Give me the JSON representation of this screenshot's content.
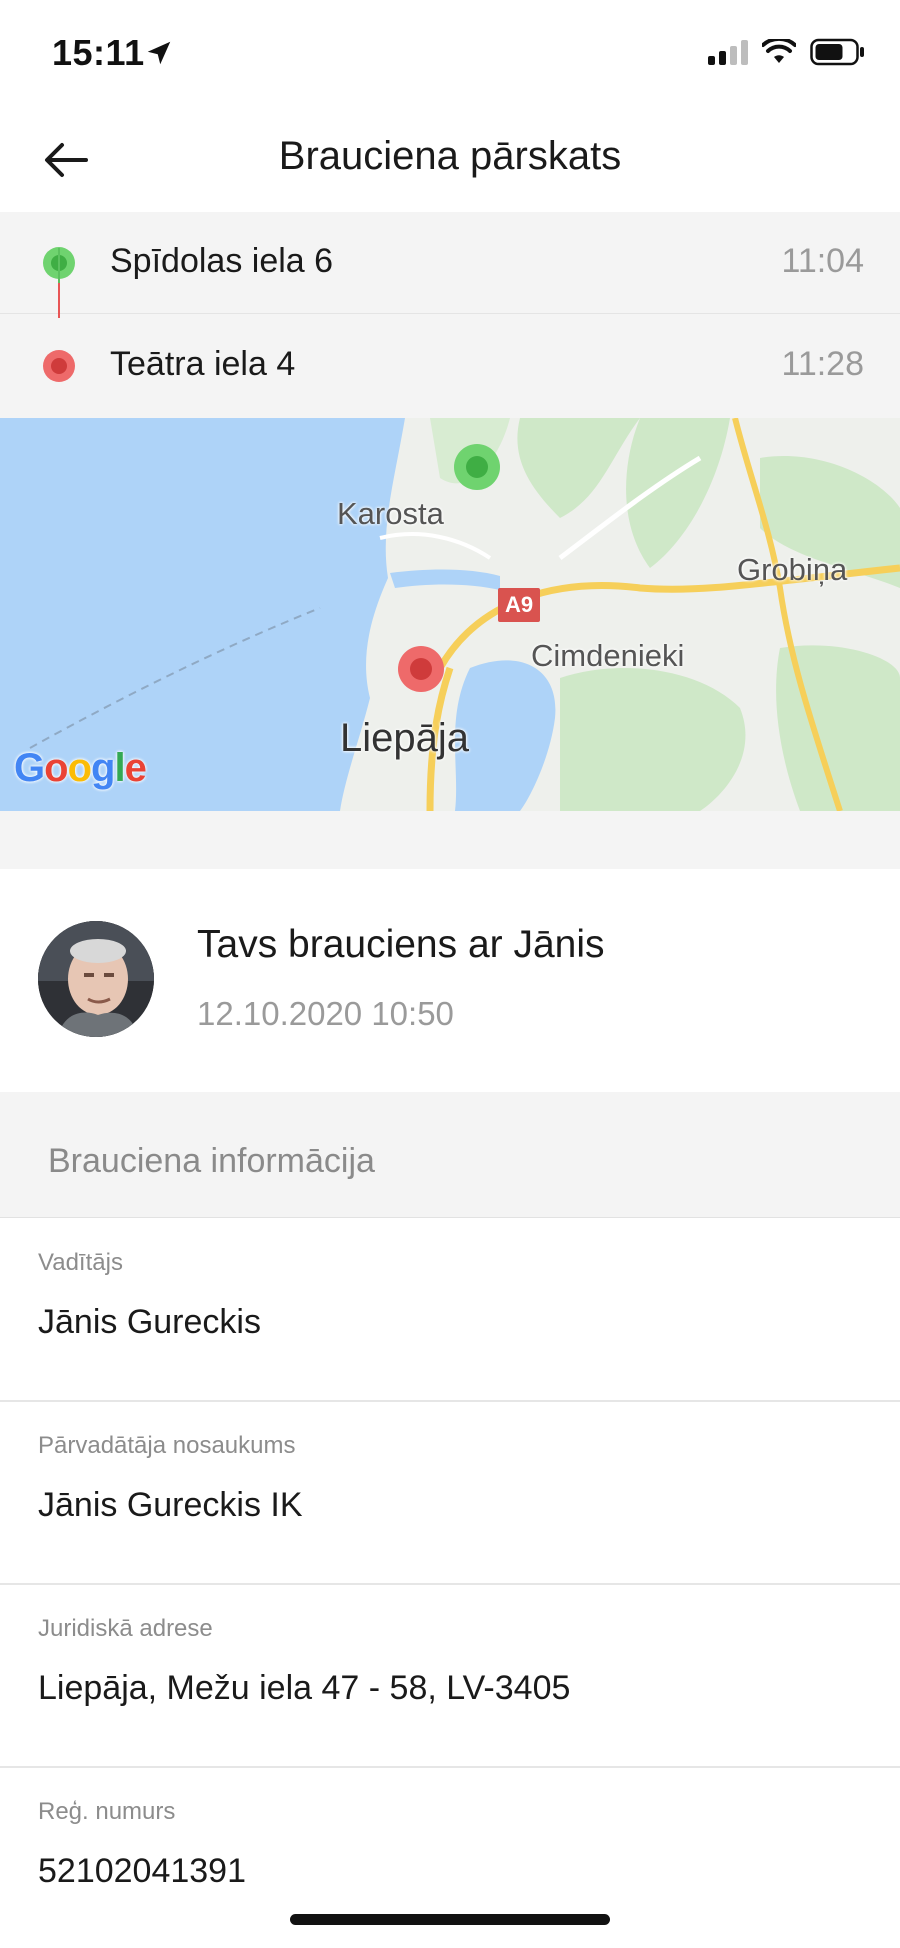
{
  "status_bar": {
    "time": "15:11",
    "location_icon": "location-arrow-icon",
    "signal_icon": "cellular-signal-icon",
    "wifi_icon": "wifi-icon",
    "battery_icon": "battery-icon",
    "battery_level": 0.7
  },
  "header": {
    "back_icon": "arrow-left-icon",
    "title": "Brauciena pārskats"
  },
  "route": {
    "stops": [
      {
        "address": "Spīdolas iela 6",
        "time": "11:04",
        "color": "#5cc05f"
      },
      {
        "address": "Teātra iela 4",
        "time": "11:28",
        "color": "#e85555"
      }
    ]
  },
  "map": {
    "labels": {
      "karosta": "Karosta",
      "grobina": "Grobiņa",
      "cimdenieki": "Cimdenieki",
      "liepaja": "Liepāja",
      "road": "A9"
    },
    "logo": {
      "g1": "G",
      "o1": "o",
      "o2": "o",
      "g2": "g",
      "l": "l",
      "e": "e"
    },
    "colors": {
      "water": "#aed3f8",
      "land": "#eef0ec",
      "park": "#cfe8c8",
      "road": "#f6cf5a"
    }
  },
  "driver": {
    "avatar_icon": "driver-avatar",
    "title": "Tavs brauciens ar Jānis",
    "date": "12.10.2020 10:50"
  },
  "info": {
    "section_title": "Brauciena informācija",
    "rows": [
      {
        "label": "Vadītājs",
        "value": "Jānis Gureckis"
      },
      {
        "label": "Pārvadātāja nosaukums",
        "value": "Jānis Gureckis IK"
      },
      {
        "label": "Juridiskā adrese",
        "value": "Liepāja, Mežu iela 47 - 58, LV-3405"
      },
      {
        "label": "Reģ. numurs",
        "value": "52102041391"
      }
    ]
  }
}
